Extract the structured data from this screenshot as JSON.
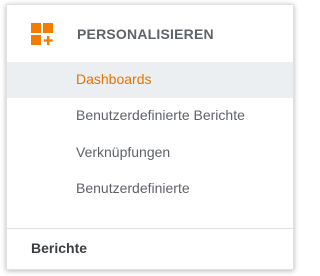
{
  "section": {
    "title": "PERSONALISIEREN",
    "icon": "customization-icon",
    "icon_color": "#f57c00"
  },
  "menu": {
    "items": [
      {
        "label": "Dashboards",
        "selected": true
      },
      {
        "label": "Benutzerdefinierte Berichte",
        "selected": false
      },
      {
        "label": "Verknüpfungen",
        "selected": false
      },
      {
        "label": "Benutzerdefinierte",
        "selected": false
      }
    ]
  },
  "footer": {
    "label": "Berichte"
  },
  "colors": {
    "accent": "#e37400",
    "selected_bg": "#eceff1",
    "text": "#5f6368"
  }
}
